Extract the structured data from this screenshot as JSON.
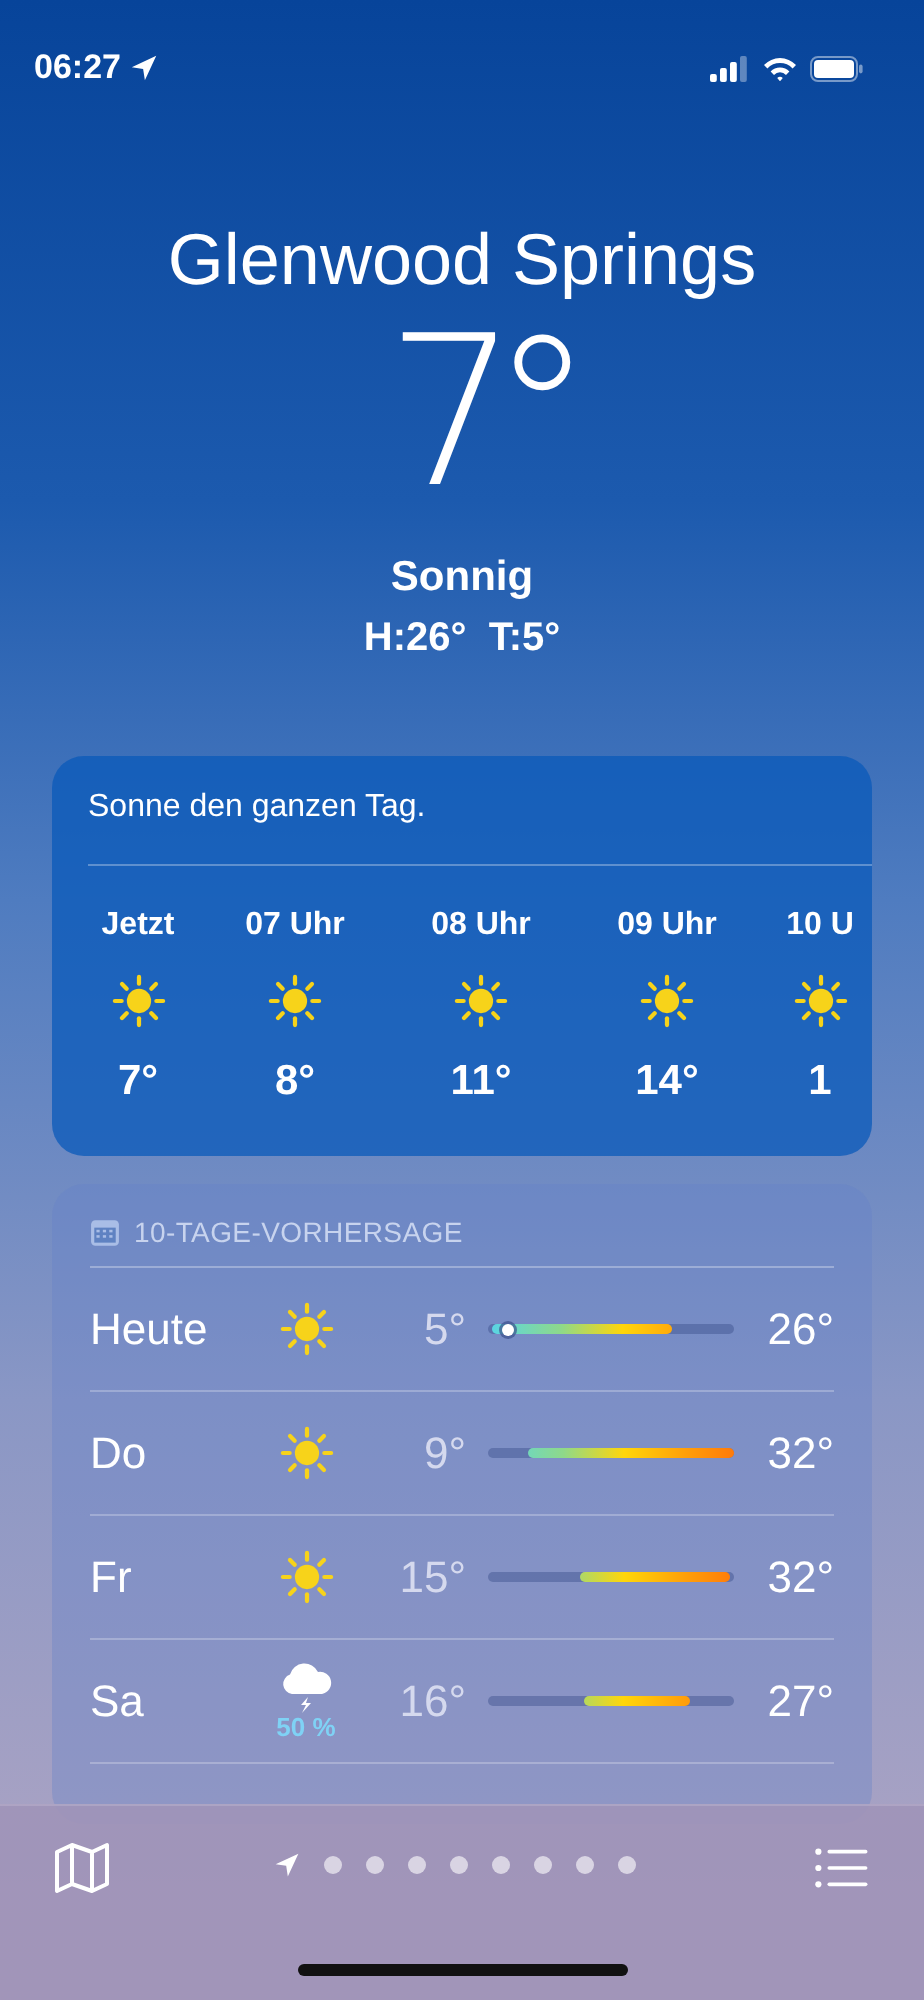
{
  "status_bar": {
    "time": "06:27",
    "location_active": true
  },
  "location": {
    "city": "Glenwood Springs",
    "temperature": "7°",
    "condition": "Sonnig",
    "high_low": "H:26°  T:5°"
  },
  "hourly": {
    "summary": "Sonne den ganzen Tag.",
    "hours": [
      {
        "label": "Jetzt",
        "kind": "sun",
        "temp": "7°"
      },
      {
        "label": "07 Uhr",
        "kind": "sun",
        "temp": "8°"
      },
      {
        "label": "08 Uhr",
        "kind": "sun",
        "temp": "11°"
      },
      {
        "label": "09 Uhr",
        "kind": "sun",
        "temp": "14°"
      },
      {
        "label": "10 U",
        "kind": "sun",
        "temp": "1"
      }
    ]
  },
  "daily": {
    "title": "10-TAGE-VORHERSAGE",
    "days": [
      {
        "day": "Heute",
        "kind": "sun",
        "low": "5°",
        "high": "26°",
        "now": {
          "level": 0.08
        }
      },
      {
        "day": "Do",
        "kind": "sun",
        "low": "9°",
        "high": "32°"
      },
      {
        "day": "Fr",
        "kind": "sun",
        "low": "15°",
        "high": "32°"
      },
      {
        "day": "Sa",
        "kind": "storm",
        "precipitation": "50 %",
        "low": "16°",
        "high": "27°"
      }
    ]
  },
  "pages": [
    {
      "kind": "location",
      "selected": true
    },
    {
      "kind": "dot",
      "selected": false
    },
    {
      "kind": "dot",
      "selected": false
    },
    {
      "kind": "dot",
      "selected": false
    },
    {
      "kind": "dot",
      "selected": false
    },
    {
      "kind": "dot",
      "selected": false
    },
    {
      "kind": "dot",
      "selected": false
    },
    {
      "kind": "dot",
      "selected": false
    },
    {
      "kind": "dot",
      "selected": false
    }
  ]
}
